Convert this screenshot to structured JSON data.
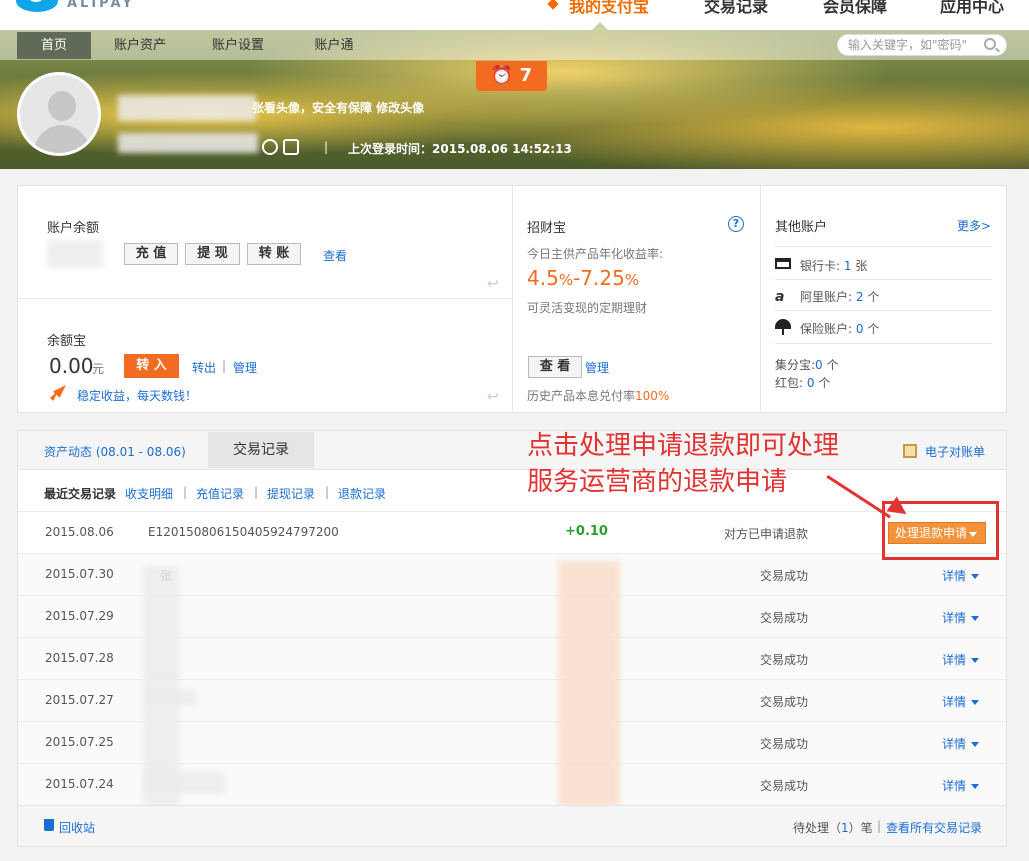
{
  "brand": {
    "logo_text": "ALIPAY"
  },
  "top_nav": {
    "items": [
      "我的支付宝",
      "交易记录",
      "会员保障",
      "应用中心"
    ]
  },
  "sub_nav": {
    "items": [
      "首页",
      "账户资产",
      "账户设置",
      "账户通"
    ]
  },
  "search": {
    "placeholder": "输入关键字，如\"密码\""
  },
  "profile": {
    "avatar_prompt": "张看头像，安全有保障 修改头像",
    "last_login_label": "上次登录时间：",
    "last_login_time": "2015.08.06 14:52:13",
    "alarm_count": "7"
  },
  "balance": {
    "title": "账户余额",
    "buttons": [
      "充 值",
      "提 现",
      "转 账"
    ],
    "view_link": "查看"
  },
  "yuebao": {
    "title": "余额宝",
    "amount": "0.00",
    "unit": "元",
    "in_button": "转 入",
    "out_link": "转出",
    "manage_link": "管理",
    "slogan": "稳定收益，每天数钱！"
  },
  "zhaocaibao": {
    "title": "招财宝",
    "rate_label": "今日主供产品年化收益率:",
    "rate_low": "4.5",
    "rate_high": "7.25",
    "percent": "%",
    "dash": "-",
    "desc": "可灵活变现的定期理财",
    "view_button": "查 看",
    "manage_link": "管理",
    "history_label": "历史产品本息兑付率",
    "history_rate": "100%"
  },
  "other_accounts": {
    "title": "其他账户",
    "more_link": "更多>",
    "bank_label": "银行卡:",
    "bank_count": "1",
    "bank_unit": "张",
    "ali_label": "阿里账户:",
    "ali_count": "2",
    "ali_unit": "个",
    "insurance_label": "保险账户:",
    "insurance_count": "0",
    "insurance_unit": "个",
    "jifen_label": "集分宝:",
    "jifen_count": "0",
    "jifen_unit": "个",
    "hongbao_label": "红包:",
    "hongbao_count": "0",
    "hongbao_unit": "个"
  },
  "tabs": {
    "asset_dynamic": "资产动态 (08.01 - 08.06)",
    "transactions": "交易记录",
    "statement": "电子对账单"
  },
  "filters": {
    "title": "最近交易记录",
    "items": [
      "收支明细",
      "充值记录",
      "提现记录",
      "退款记录"
    ]
  },
  "annotation": {
    "line1": "点击处理申请退款即可处理",
    "line2": "服务运营商的退款申请"
  },
  "transactions": [
    {
      "date": "2015.08.06",
      "name": "E12015080615040592479720​0",
      "amount": "+0.10",
      "status": "对方已申请退款",
      "action": "处理退款申请"
    },
    {
      "date": "2015.07.30",
      "name": "张",
      "amount": "",
      "status": "交易成功",
      "action": "详情"
    },
    {
      "date": "2015.07.29",
      "name": "",
      "amount": "",
      "status": "交易成功",
      "action": "详情"
    },
    {
      "date": "2015.07.28",
      "name": "",
      "amount": "",
      "status": "交易成功",
      "action": "详情"
    },
    {
      "date": "2015.07.27",
      "name": "",
      "amount": "",
      "status": "交易成功",
      "action": "详情"
    },
    {
      "date": "2015.07.25",
      "name": "",
      "amount": "",
      "status": "交易成功",
      "action": "详情"
    },
    {
      "date": "2015.07.24",
      "name": "",
      "amount": "",
      "status": "交易成功",
      "action": "详情"
    }
  ],
  "footer": {
    "recycle_link": "回收站",
    "pending_prefix": "待处理（",
    "pending_count": "1",
    "pending_suffix": "）笔",
    "view_all_link": "查看所有交易记录"
  }
}
